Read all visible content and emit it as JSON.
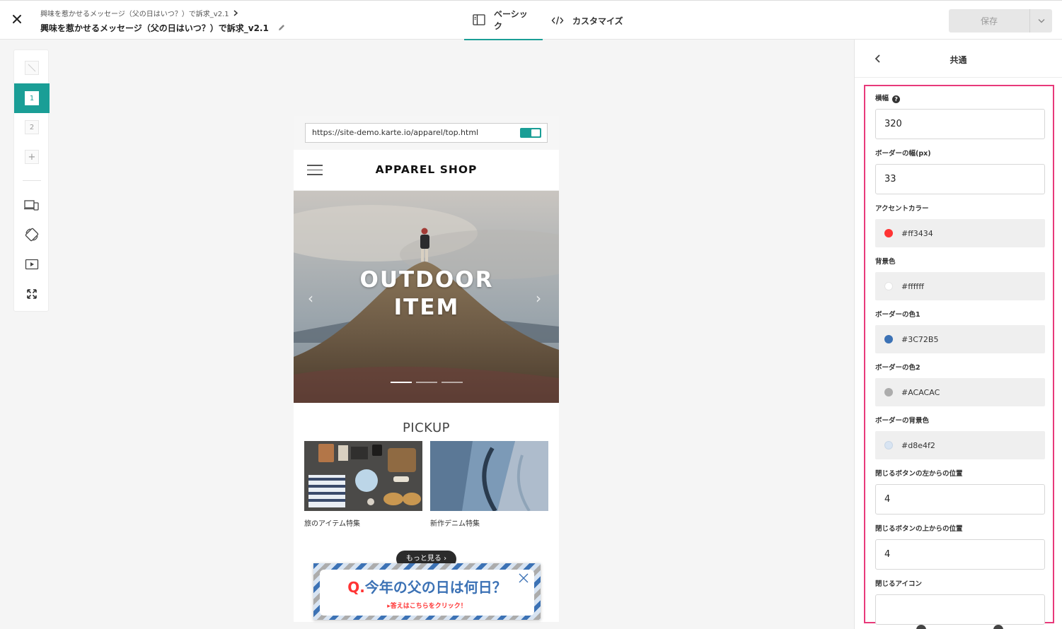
{
  "header": {
    "breadcrumb": "興味を惹かせるメッセージ（父の日はいつ？）で訴求_v2.1",
    "title": "興味を惹かせるメッセージ（父の日はいつ？）で訴求_v2.1",
    "tabs": [
      {
        "label": "ベーシック",
        "icon": "sidebar-layout-icon",
        "active": true
      },
      {
        "label": "カスタマイズ",
        "icon": "code-icon",
        "active": false
      }
    ],
    "save_label": "保存"
  },
  "toolbar": {
    "variants": [
      "1",
      "2"
    ],
    "add_label": "+"
  },
  "preview": {
    "url": "https://site-demo.karte.io/apparel/top.html",
    "shop_name": "APPAREL SHOP",
    "hero_title_line1": "OUTDOOR",
    "hero_title_line2": "ITEM",
    "pickup_title": "PICKUP",
    "pickup_items": [
      {
        "caption": "旅のアイテム特集"
      },
      {
        "caption": "新作デニム特集"
      }
    ],
    "more_button": "もっと見る"
  },
  "banner": {
    "q_prefix": "Q.",
    "question": "今年の父の日は何日？",
    "sub": "答えはこちらをクリック！"
  },
  "panel": {
    "title": "共通",
    "fields": {
      "width_label": "横幅",
      "width_value": "320",
      "border_width_label": "ボーダーの幅(px)",
      "border_width_value": "33",
      "accent_label": "アクセントカラー",
      "accent_value": "#ff3434",
      "bg_label": "背景色",
      "bg_value": "#ffffff",
      "border1_label": "ボーダーの色1",
      "border1_value": "#3C72B5",
      "border2_label": "ボーダーの色2",
      "border2_value": "#ACACAC",
      "border_bg_label": "ボーダーの背景色",
      "border_bg_value": "#d8e4f2",
      "close_left_label": "閉じるボタンの左からの位置",
      "close_left_value": "4",
      "close_top_label": "閉じるボタンの上からの位置",
      "close_top_value": "4",
      "close_icon_label": "閉じるアイコン",
      "close_icon_value": ""
    }
  },
  "colors": {
    "brand": "#1a9e96",
    "highlight": "#e8397a",
    "accent": "#ff3434",
    "border1": "#3C72B5",
    "border2": "#ACACAC",
    "border_bg": "#d8e4f2"
  }
}
